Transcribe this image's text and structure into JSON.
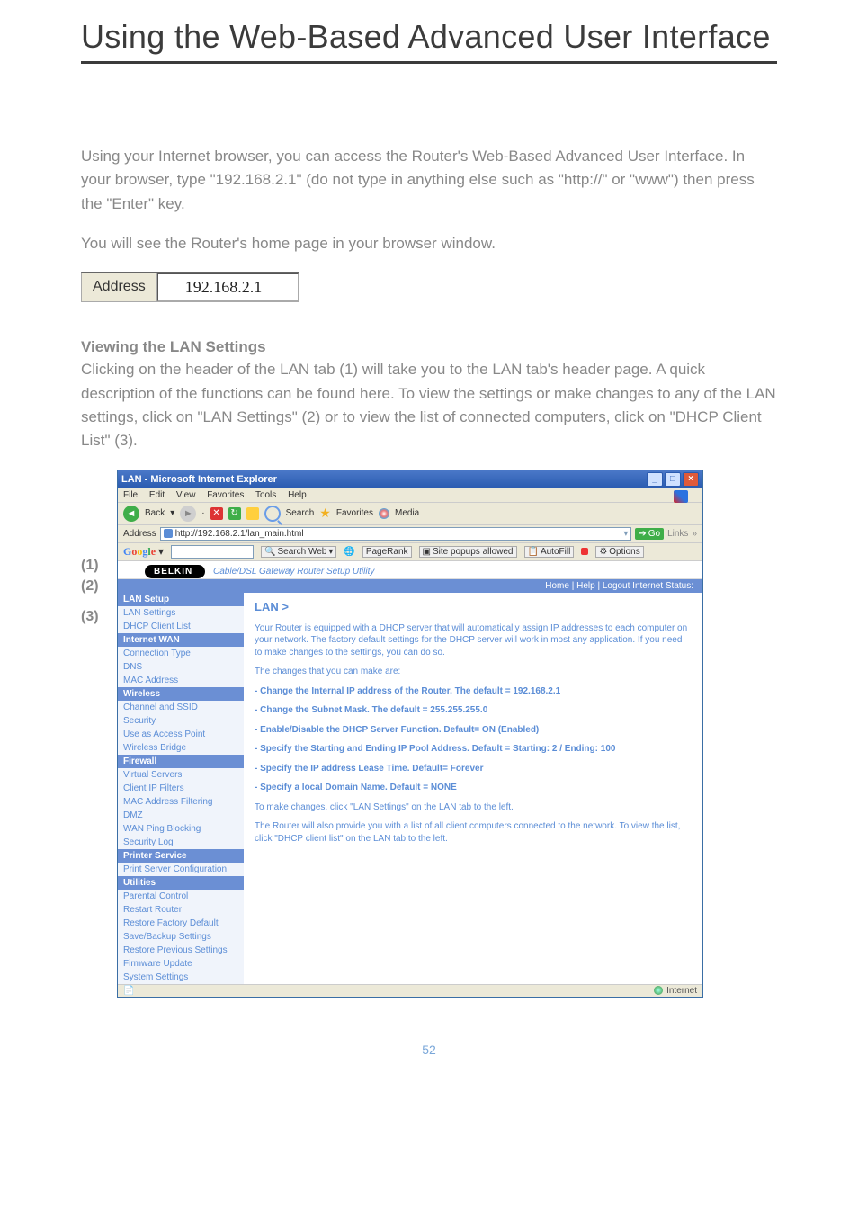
{
  "page_title": "Using the Web-Based Advanced User Interface",
  "intro1": "Using your Internet browser, you can access the Router's Web-Based Advanced User Interface. In your browser, type \"192.168.2.1\" (do not type in anything else such as \"http://\" or \"www\") then press the \"Enter\" key.",
  "intro2": "You will see the Router's home page in your browser window.",
  "address_bar": {
    "label": "Address",
    "value": "192.168.2.1"
  },
  "section_heading": "Viewing the LAN Settings",
  "section_body": "Clicking on the header of the LAN tab (1) will take you to the LAN tab's header page. A quick description of the functions can be found here. To view the settings or make changes to any of the LAN settings, click on \"LAN Settings\" (2) or to view the list of connected computers, click on \"DHCP Client List\" (3).",
  "refs": {
    "r1": "(1)",
    "r2": "(2)",
    "r3": "(3)"
  },
  "ie": {
    "title": "LAN - Microsoft Internet Explorer",
    "menus": [
      "File",
      "Edit",
      "View",
      "Favorites",
      "Tools",
      "Help"
    ],
    "toolbar": {
      "back": "Back",
      "search": "Search",
      "favorites": "Favorites",
      "media": "Media"
    },
    "addrbar": {
      "label": "Address",
      "url": "http://192.168.2.1/lan_main.html",
      "go": "Go",
      "links": "Links"
    },
    "google": {
      "logo": "Google",
      "searchweb": "Search Web",
      "pagerank": "PageRank",
      "popups": "Site popups allowed",
      "autofill": "AutoFill",
      "options": "Options"
    },
    "belkin": {
      "brand": "BELKIN",
      "subtitle": "Cable/DSL Gateway Router Setup Utility"
    },
    "status_links": "Home | Help | Logout    Internet Status:",
    "nav": {
      "lan_setup": "LAN Setup",
      "lan_settings": "LAN Settings",
      "dhcp_list": "DHCP Client List",
      "internet_wan": "Internet WAN",
      "conn_type": "Connection Type",
      "dns": "DNS",
      "mac": "MAC Address",
      "wireless": "Wireless",
      "channel": "Channel and SSID",
      "security": "Security",
      "use_ap": "Use as Access Point",
      "wbridge": "Wireless Bridge",
      "firewall": "Firewall",
      "vservers": "Virtual Servers",
      "ipfilters": "Client IP Filters",
      "macfilter": "MAC Address Filtering",
      "dmz": "DMZ",
      "wanping": "WAN Ping Blocking",
      "seclog": "Security Log",
      "printer": "Printer Service",
      "printcfg": "Print Server Configuration",
      "utilities": "Utilities",
      "parental": "Parental Control",
      "restart": "Restart Router",
      "factory": "Restore Factory Default",
      "savebak": "Save/Backup Settings",
      "restoreprev": "Restore Previous Settings",
      "fwupdate": "Firmware Update",
      "syssettings": "System Settings"
    },
    "main": {
      "heading": "LAN >",
      "p1": "Your Router is equipped with a DHCP server that will automatically assign IP addresses to each computer on your network. The factory default settings for the DHCP server will work in most any application. If you need to make changes to the settings, you can do so.",
      "p2": "The changes that you can make are:",
      "b1": "- Change the Internal IP address of the Router. The default = 192.168.2.1",
      "b2": "- Change the Subnet Mask. The default = 255.255.255.0",
      "b3": "- Enable/Disable the DHCP Server Function. Default= ON (Enabled)",
      "b4": "- Specify the Starting and Ending IP Pool Address. Default = Starting: 2 / Ending: 100",
      "b5": "- Specify the IP address Lease Time. Default= Forever",
      "b6": "- Specify a local Domain Name. Default = NONE",
      "p3": "To make changes, click \"LAN Settings\" on the LAN tab to the left.",
      "p4": "The Router will also provide you with a list of all client computers connected to the network. To view the list, click \"DHCP client list\" on the LAN tab to the left."
    },
    "ie_status": "Internet"
  },
  "page_number": "52"
}
